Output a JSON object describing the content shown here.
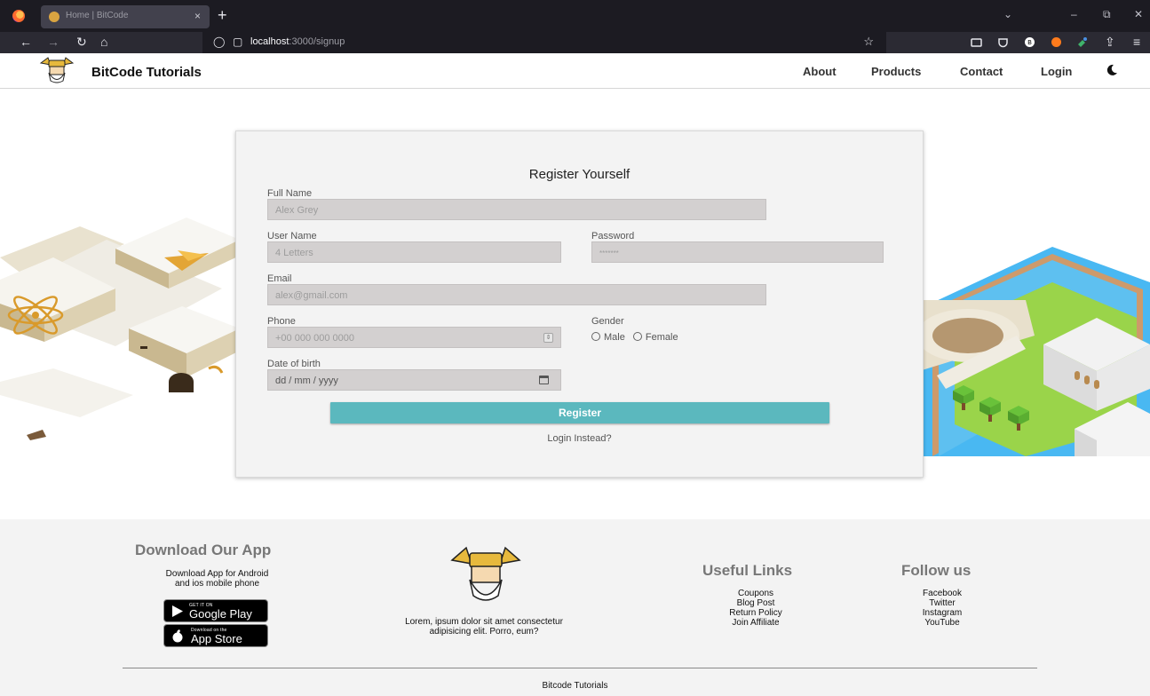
{
  "browser": {
    "tab_title": "Home | BitCode",
    "url_host": "localhost",
    "url_rest": ":3000/signup"
  },
  "site": {
    "brand": "BitCode Tutorials",
    "nav": [
      "About",
      "Products",
      "Contact",
      "Login"
    ]
  },
  "form": {
    "title": "Register Yourself",
    "full_name": {
      "label": "Full Name",
      "placeholder": "Alex Grey"
    },
    "user_name": {
      "label": "User Name",
      "placeholder": "4 Letters"
    },
    "password": {
      "label": "Password",
      "placeholder": "*******"
    },
    "email": {
      "label": "Email",
      "placeholder": "alex@gmail.com"
    },
    "phone": {
      "label": "Phone",
      "placeholder": "+00 000 000 0000"
    },
    "gender": {
      "label": "Gender",
      "options": [
        "Male",
        "Female"
      ]
    },
    "dob": {
      "label": "Date of birth",
      "placeholder": "dd / mm / yyyy"
    },
    "submit": "Register",
    "alt_link": "Login Instead?"
  },
  "footer": {
    "download": {
      "heading": "Download Our App",
      "line1": "Download App for Android",
      "line2": "and ios mobile phone",
      "google_small": "GET IT ON",
      "google_big": "Google Play",
      "apple_small": "Download on the",
      "apple_big": "App Store"
    },
    "about": {
      "line1": "Lorem, ipsum dolor sit amet consectetur",
      "line2": "adipisicing elit. Porro, eum?"
    },
    "useful": {
      "heading": "Useful Links",
      "links": [
        "Coupons",
        "Blog Post",
        "Return Policy",
        "Join Affiliate"
      ]
    },
    "follow": {
      "heading": "Follow us",
      "links": [
        "Facebook",
        "Twitter",
        "Instagram",
        "YouTube"
      ]
    },
    "copyright": "Bitcode Tutorials"
  },
  "colors": {
    "accent": "#5bb8be",
    "input_bg": "#d3d0d0",
    "card_bg": "#f3f3f3",
    "chrome_dark": "#1c1b22"
  }
}
